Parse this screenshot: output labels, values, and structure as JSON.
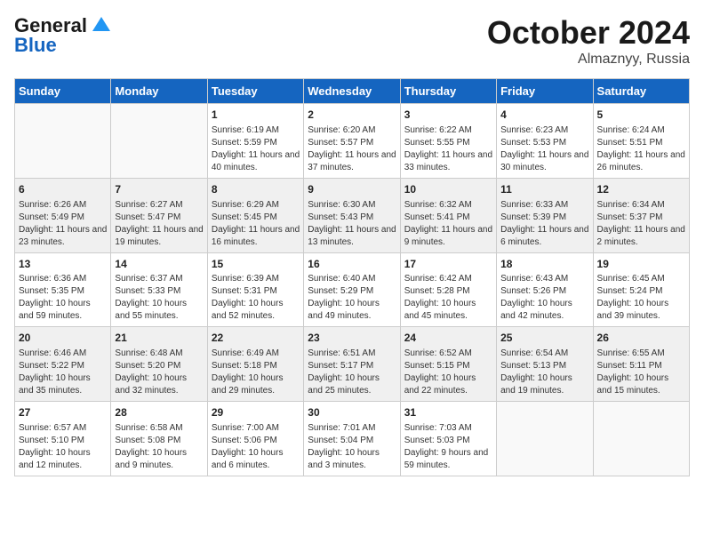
{
  "header": {
    "logo_line1": "General",
    "logo_line2": "Blue",
    "title": "October 2024",
    "subtitle": "Almaznyy, Russia"
  },
  "days_of_week": [
    "Sunday",
    "Monday",
    "Tuesday",
    "Wednesday",
    "Thursday",
    "Friday",
    "Saturday"
  ],
  "weeks": [
    [
      {
        "day": "",
        "sunrise": "",
        "sunset": "",
        "daylight": ""
      },
      {
        "day": "",
        "sunrise": "",
        "sunset": "",
        "daylight": ""
      },
      {
        "day": "1",
        "sunrise": "Sunrise: 6:19 AM",
        "sunset": "Sunset: 5:59 PM",
        "daylight": "Daylight: 11 hours and 40 minutes."
      },
      {
        "day": "2",
        "sunrise": "Sunrise: 6:20 AM",
        "sunset": "Sunset: 5:57 PM",
        "daylight": "Daylight: 11 hours and 37 minutes."
      },
      {
        "day": "3",
        "sunrise": "Sunrise: 6:22 AM",
        "sunset": "Sunset: 5:55 PM",
        "daylight": "Daylight: 11 hours and 33 minutes."
      },
      {
        "day": "4",
        "sunrise": "Sunrise: 6:23 AM",
        "sunset": "Sunset: 5:53 PM",
        "daylight": "Daylight: 11 hours and 30 minutes."
      },
      {
        "day": "5",
        "sunrise": "Sunrise: 6:24 AM",
        "sunset": "Sunset: 5:51 PM",
        "daylight": "Daylight: 11 hours and 26 minutes."
      }
    ],
    [
      {
        "day": "6",
        "sunrise": "Sunrise: 6:26 AM",
        "sunset": "Sunset: 5:49 PM",
        "daylight": "Daylight: 11 hours and 23 minutes."
      },
      {
        "day": "7",
        "sunrise": "Sunrise: 6:27 AM",
        "sunset": "Sunset: 5:47 PM",
        "daylight": "Daylight: 11 hours and 19 minutes."
      },
      {
        "day": "8",
        "sunrise": "Sunrise: 6:29 AM",
        "sunset": "Sunset: 5:45 PM",
        "daylight": "Daylight: 11 hours and 16 minutes."
      },
      {
        "day": "9",
        "sunrise": "Sunrise: 6:30 AM",
        "sunset": "Sunset: 5:43 PM",
        "daylight": "Daylight: 11 hours and 13 minutes."
      },
      {
        "day": "10",
        "sunrise": "Sunrise: 6:32 AM",
        "sunset": "Sunset: 5:41 PM",
        "daylight": "Daylight: 11 hours and 9 minutes."
      },
      {
        "day": "11",
        "sunrise": "Sunrise: 6:33 AM",
        "sunset": "Sunset: 5:39 PM",
        "daylight": "Daylight: 11 hours and 6 minutes."
      },
      {
        "day": "12",
        "sunrise": "Sunrise: 6:34 AM",
        "sunset": "Sunset: 5:37 PM",
        "daylight": "Daylight: 11 hours and 2 minutes."
      }
    ],
    [
      {
        "day": "13",
        "sunrise": "Sunrise: 6:36 AM",
        "sunset": "Sunset: 5:35 PM",
        "daylight": "Daylight: 10 hours and 59 minutes."
      },
      {
        "day": "14",
        "sunrise": "Sunrise: 6:37 AM",
        "sunset": "Sunset: 5:33 PM",
        "daylight": "Daylight: 10 hours and 55 minutes."
      },
      {
        "day": "15",
        "sunrise": "Sunrise: 6:39 AM",
        "sunset": "Sunset: 5:31 PM",
        "daylight": "Daylight: 10 hours and 52 minutes."
      },
      {
        "day": "16",
        "sunrise": "Sunrise: 6:40 AM",
        "sunset": "Sunset: 5:29 PM",
        "daylight": "Daylight: 10 hours and 49 minutes."
      },
      {
        "day": "17",
        "sunrise": "Sunrise: 6:42 AM",
        "sunset": "Sunset: 5:28 PM",
        "daylight": "Daylight: 10 hours and 45 minutes."
      },
      {
        "day": "18",
        "sunrise": "Sunrise: 6:43 AM",
        "sunset": "Sunset: 5:26 PM",
        "daylight": "Daylight: 10 hours and 42 minutes."
      },
      {
        "day": "19",
        "sunrise": "Sunrise: 6:45 AM",
        "sunset": "Sunset: 5:24 PM",
        "daylight": "Daylight: 10 hours and 39 minutes."
      }
    ],
    [
      {
        "day": "20",
        "sunrise": "Sunrise: 6:46 AM",
        "sunset": "Sunset: 5:22 PM",
        "daylight": "Daylight: 10 hours and 35 minutes."
      },
      {
        "day": "21",
        "sunrise": "Sunrise: 6:48 AM",
        "sunset": "Sunset: 5:20 PM",
        "daylight": "Daylight: 10 hours and 32 minutes."
      },
      {
        "day": "22",
        "sunrise": "Sunrise: 6:49 AM",
        "sunset": "Sunset: 5:18 PM",
        "daylight": "Daylight: 10 hours and 29 minutes."
      },
      {
        "day": "23",
        "sunrise": "Sunrise: 6:51 AM",
        "sunset": "Sunset: 5:17 PM",
        "daylight": "Daylight: 10 hours and 25 minutes."
      },
      {
        "day": "24",
        "sunrise": "Sunrise: 6:52 AM",
        "sunset": "Sunset: 5:15 PM",
        "daylight": "Daylight: 10 hours and 22 minutes."
      },
      {
        "day": "25",
        "sunrise": "Sunrise: 6:54 AM",
        "sunset": "Sunset: 5:13 PM",
        "daylight": "Daylight: 10 hours and 19 minutes."
      },
      {
        "day": "26",
        "sunrise": "Sunrise: 6:55 AM",
        "sunset": "Sunset: 5:11 PM",
        "daylight": "Daylight: 10 hours and 15 minutes."
      }
    ],
    [
      {
        "day": "27",
        "sunrise": "Sunrise: 6:57 AM",
        "sunset": "Sunset: 5:10 PM",
        "daylight": "Daylight: 10 hours and 12 minutes."
      },
      {
        "day": "28",
        "sunrise": "Sunrise: 6:58 AM",
        "sunset": "Sunset: 5:08 PM",
        "daylight": "Daylight: 10 hours and 9 minutes."
      },
      {
        "day": "29",
        "sunrise": "Sunrise: 7:00 AM",
        "sunset": "Sunset: 5:06 PM",
        "daylight": "Daylight: 10 hours and 6 minutes."
      },
      {
        "day": "30",
        "sunrise": "Sunrise: 7:01 AM",
        "sunset": "Sunset: 5:04 PM",
        "daylight": "Daylight: 10 hours and 3 minutes."
      },
      {
        "day": "31",
        "sunrise": "Sunrise: 7:03 AM",
        "sunset": "Sunset: 5:03 PM",
        "daylight": "Daylight: 9 hours and 59 minutes."
      },
      {
        "day": "",
        "sunrise": "",
        "sunset": "",
        "daylight": ""
      },
      {
        "day": "",
        "sunrise": "",
        "sunset": "",
        "daylight": ""
      }
    ]
  ]
}
